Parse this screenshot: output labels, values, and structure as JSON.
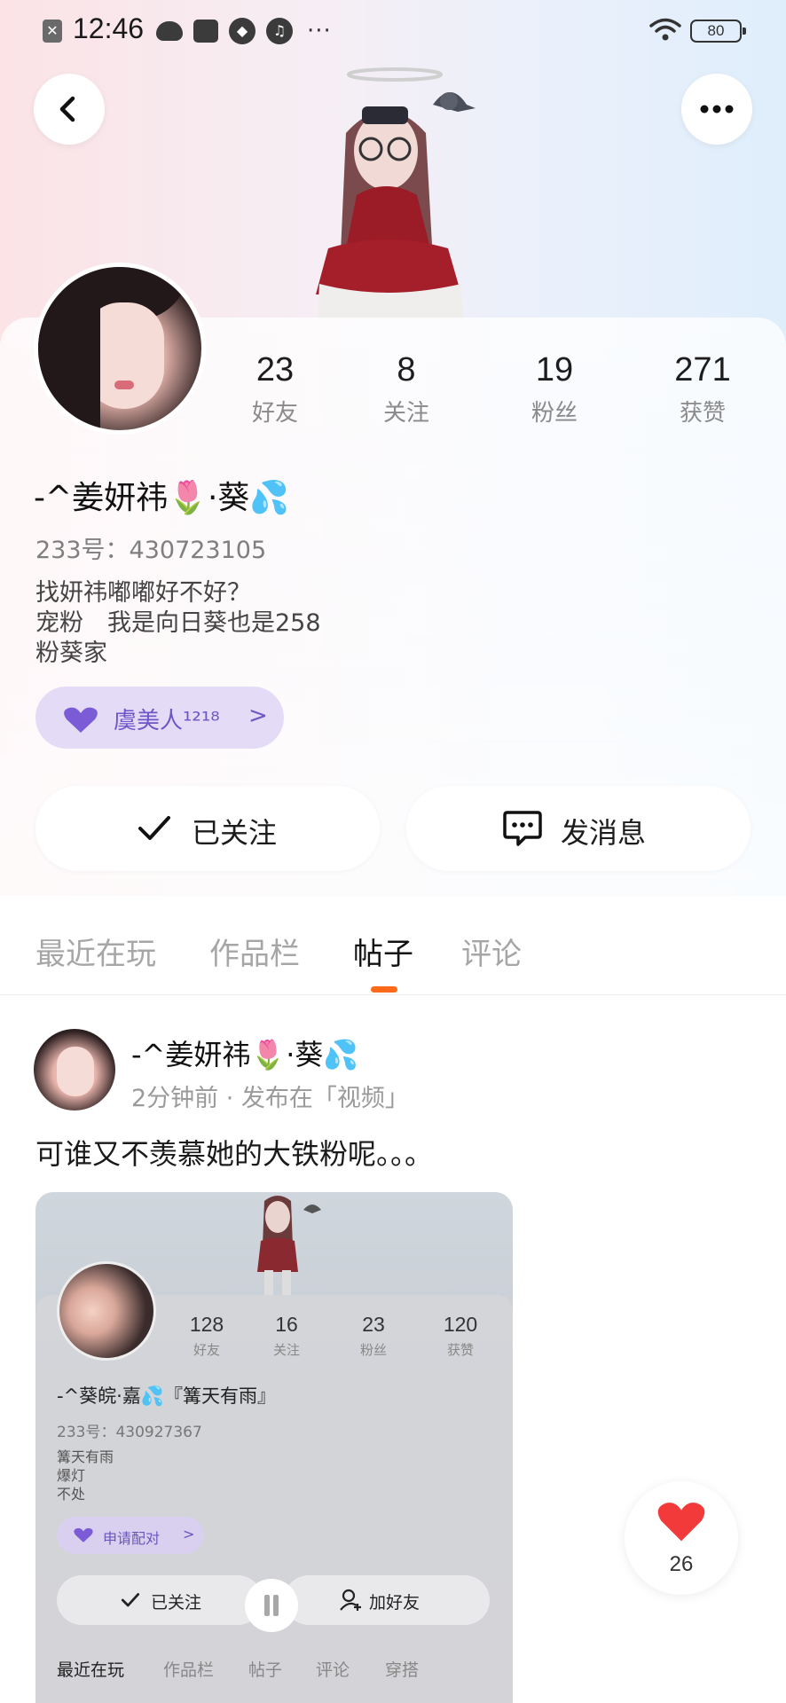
{
  "status_bar": {
    "time": "12:46",
    "battery": "80"
  },
  "profile": {
    "nickname": "-^姜妍祎🌷·葵💦",
    "uid": "233号：430723105",
    "bio": "找妍祎嘟嘟好不好？\n宠粉　我是向日葵也是258\n粉葵家",
    "stats": [
      {
        "value": "23",
        "label": "好友"
      },
      {
        "value": "8",
        "label": "关注"
      },
      {
        "value": "19",
        "label": "粉丝"
      },
      {
        "value": "271",
        "label": "获赞"
      }
    ],
    "pair_chip": {
      "label": "虞美人¹²¹⁸",
      "chevron": ">"
    },
    "follow_button": "已关注",
    "message_button": "发消息"
  },
  "tabs": [
    "最近在玩",
    "作品栏",
    "帖子",
    "评论"
  ],
  "active_tab": "帖子",
  "post": {
    "author": "-^姜妍祎🌷·葵💦",
    "meta": "2分钟前 · 发布在「视频」",
    "text": "可谁又不羡慕她的大铁粉呢。。。",
    "media": {
      "stats": [
        {
          "value": "128",
          "label": "好友"
        },
        {
          "value": "16",
          "label": "关注"
        },
        {
          "value": "23",
          "label": "粉丝"
        },
        {
          "value": "120",
          "label": "获赞"
        }
      ],
      "name": "-^葵皖·嘉💦『篝天有雨』",
      "uid": "233号：430927367",
      "bio": "篝天有雨\n爆灯\n不处",
      "chip": "申请配对",
      "chip_chevron": ">",
      "follow": "已关注",
      "add_friend": "加好友",
      "tabs": [
        "最近在玩",
        "作品栏",
        "帖子",
        "评论",
        "穿搭"
      ]
    },
    "likes": "26"
  },
  "colors": {
    "accent_orange": "#ff6a1a",
    "chip_purple": "#6f56c8",
    "like_red": "#f23a3a"
  }
}
